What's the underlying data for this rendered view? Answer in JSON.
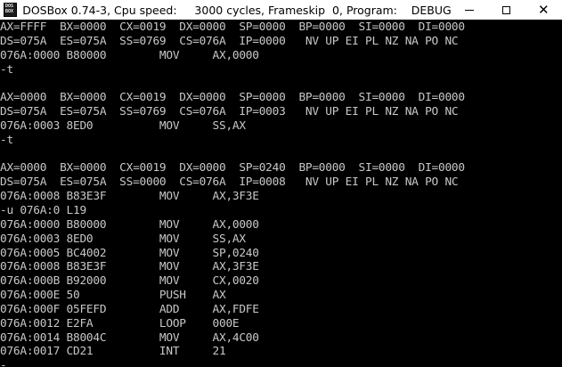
{
  "window": {
    "title": "DOSBox 0.74-3, Cpu speed:     3000 cycles, Frameskip  0, Program:    DEBUG",
    "icon_rows": [
      "DOS",
      "BOX"
    ],
    "controls": {
      "minimize": "minimize-icon",
      "maximize": "maximize-icon",
      "close": "✕"
    }
  },
  "console": {
    "lines": [
      "AX=FFFF  BX=0000  CX=0019  DX=0000  SP=0000  BP=0000  SI=0000  DI=0000",
      "DS=075A  ES=075A  SS=0769  CS=076A  IP=0000   NV UP EI PL NZ NA PO NC",
      "076A:0000 B80000        MOV     AX,0000",
      "-t",
      "",
      "AX=0000  BX=0000  CX=0019  DX=0000  SP=0000  BP=0000  SI=0000  DI=0000",
      "DS=075A  ES=075A  SS=0769  CS=076A  IP=0003   NV UP EI PL NZ NA PO NC",
      "076A:0003 8ED0          MOV     SS,AX",
      "-t",
      "",
      "AX=0000  BX=0000  CX=0019  DX=0000  SP=0240  BP=0000  SI=0000  DI=0000",
      "DS=075A  ES=075A  SS=0000  CS=076A  IP=0008   NV UP EI PL NZ NA PO NC",
      "076A:0008 B83E3F        MOV     AX,3F3E",
      "-u 076A:0 L19",
      "076A:0000 B80000        MOV     AX,0000",
      "076A:0003 8ED0          MOV     SS,AX",
      "076A:0005 BC4002        MOV     SP,0240",
      "076A:0008 B83E3F        MOV     AX,3F3E",
      "076A:000B B92000        MOV     CX,0020",
      "076A:000E 50            PUSH    AX",
      "076A:000F 05FEFD        ADD     AX,FDFE",
      "076A:0012 E2FA          LOOP    000E",
      "076A:0014 B8004C        MOV     AX,4C00",
      "076A:0017 CD21          INT     21",
      "-"
    ]
  },
  "colors": {
    "console_bg": "#000000",
    "console_text": "#c8c8c8",
    "titlebar_bg": "#ffffff"
  }
}
